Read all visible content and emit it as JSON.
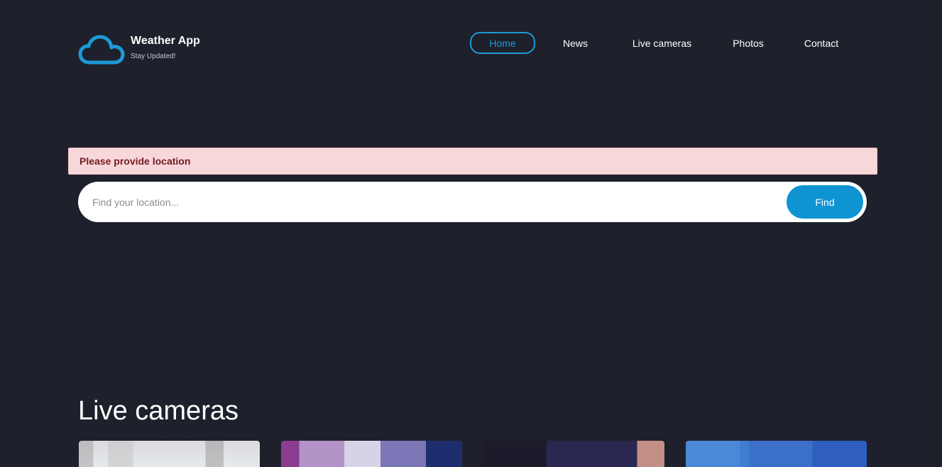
{
  "brand": {
    "title": "Weather App",
    "tagline": "Stay Updated!",
    "logo_icon": "cloud-icon",
    "accent_color": "#1b9ad8"
  },
  "nav": {
    "items": [
      {
        "label": "Home",
        "active": true
      },
      {
        "label": "News",
        "active": false
      },
      {
        "label": "Live cameras",
        "active": false
      },
      {
        "label": "Photos",
        "active": false
      },
      {
        "label": "Contact",
        "active": false
      }
    ]
  },
  "alert": {
    "message": "Please provide location",
    "background": "#f8d7da",
    "text_color": "#721c24"
  },
  "search": {
    "placeholder": "Find your location...",
    "value": "",
    "button_label": "Find",
    "button_color": "#0f94d2"
  },
  "live_cameras": {
    "heading": "Live cameras"
  },
  "colors": {
    "page_background": "#1e202b"
  }
}
